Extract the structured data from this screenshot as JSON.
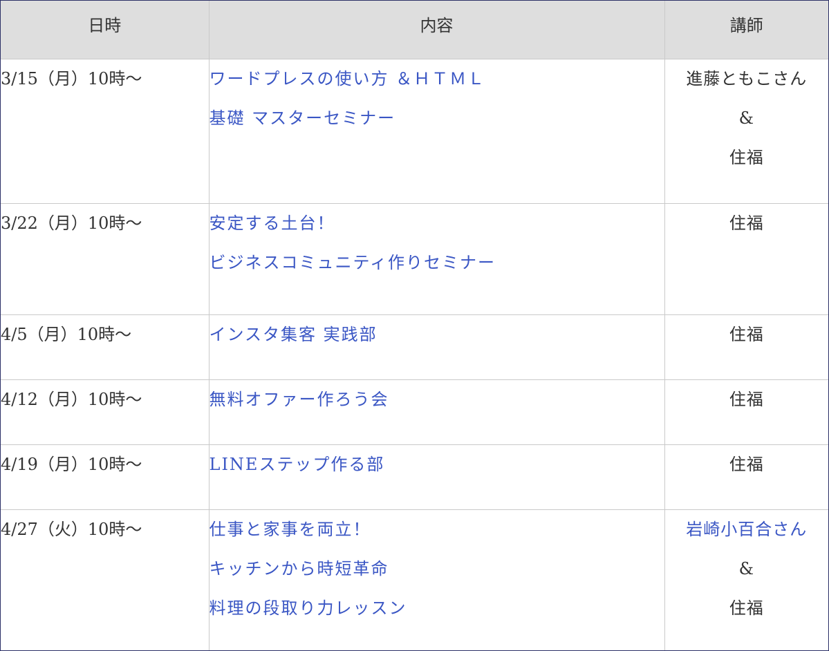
{
  "table": {
    "headers": {
      "date": "日時",
      "content": "内容",
      "instructor": "講師"
    },
    "rows": [
      {
        "date": "3/15（月）10時～",
        "content": [
          "ワードプレスの使い方 ＆ＨＴＭＬ",
          "基礎 マスターセミナー"
        ],
        "instructor": [
          "進藤ともこさん",
          "&",
          "住福"
        ]
      },
      {
        "date": "3/22（月）10時～",
        "content": [
          "安定する土台！",
          "ビジネスコミュニティ作りセミナー"
        ],
        "instructor": [
          "住福"
        ]
      },
      {
        "date": "4/5（月）10時～",
        "content": [
          "インスタ集客 実践部"
        ],
        "instructor": [
          "住福"
        ]
      },
      {
        "date": "4/12（月）10時～",
        "content": [
          "無料オファー作ろう会"
        ],
        "instructor": [
          "住福"
        ]
      },
      {
        "date": "4/19（月）10時～",
        "content": [
          "LINEステップ作る部"
        ],
        "instructor": [
          "住福"
        ]
      },
      {
        "date": "4/27（火）10時～",
        "content": [
          "仕事と家事を両立！",
          "キッチンから時短革命",
          "料理の段取り力レッスン"
        ],
        "instructor": [
          "岩崎小百合さん",
          "&",
          "住福"
        ]
      }
    ]
  },
  "colors": {
    "header_background": "#dedede",
    "link_text": "#3a56c4",
    "body_text": "#333333",
    "grid_line": "#c9c9c9",
    "frame_border": "#2b2f66"
  }
}
